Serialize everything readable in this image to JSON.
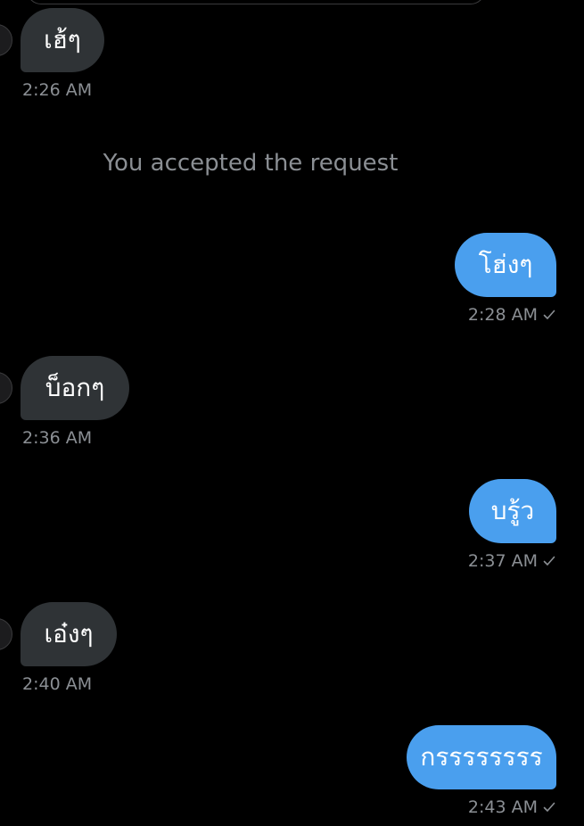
{
  "theme": {
    "background": "#000000",
    "incoming_bubble": "#2f3336",
    "outgoing_bubble": "#4a9fee",
    "meta_text": "#8b8f94"
  },
  "system_notice": "You accepted the request",
  "messages": [
    {
      "direction": "incoming",
      "text": "เฮ้ๆ",
      "time": "2:26 AM"
    },
    {
      "direction": "outgoing",
      "text": "โฮ่งๆ",
      "time": "2:28 AM",
      "status_icon": "check-icon"
    },
    {
      "direction": "incoming",
      "text": "บ็อกๆ",
      "time": "2:36 AM"
    },
    {
      "direction": "outgoing",
      "text": "บรู้ว",
      "time": "2:37 AM",
      "status_icon": "check-icon"
    },
    {
      "direction": "incoming",
      "text": "เอ๋งๆ",
      "time": "2:40 AM"
    },
    {
      "direction": "outgoing",
      "text": "กรรรรรรรร",
      "time": "2:43 AM",
      "status_icon": "check-icon"
    }
  ]
}
